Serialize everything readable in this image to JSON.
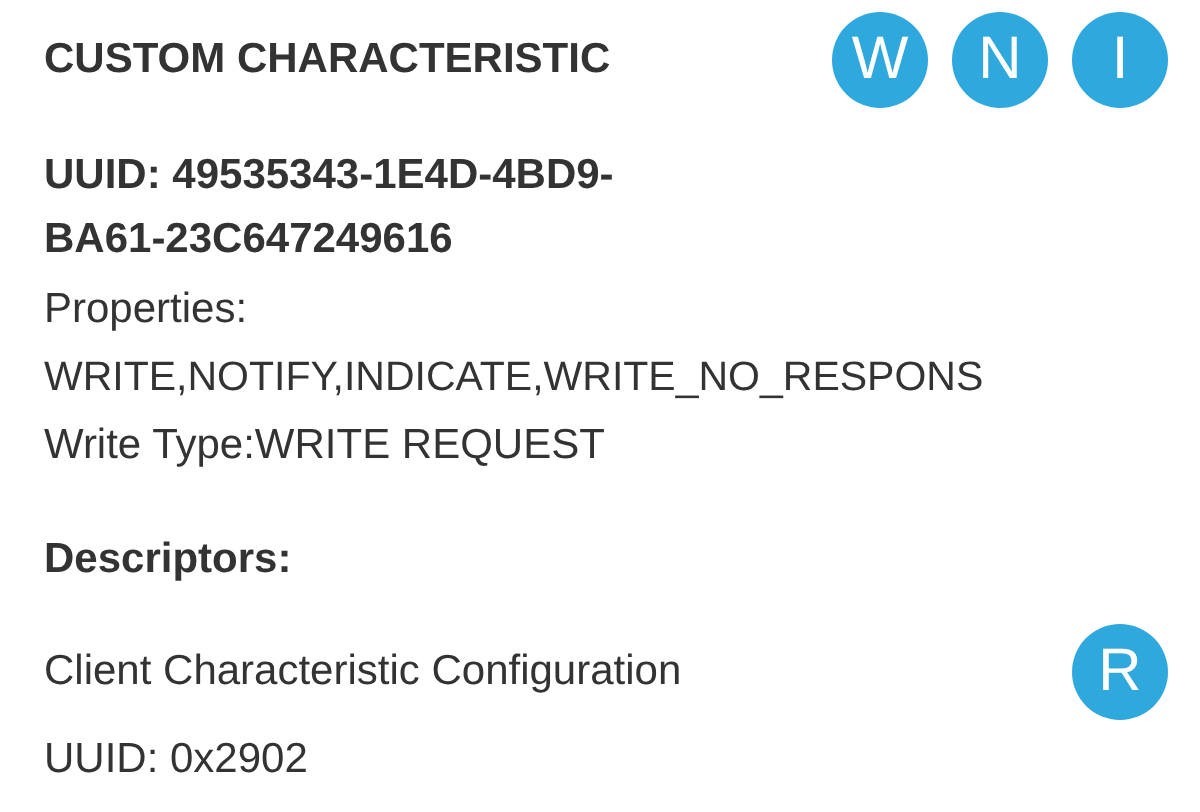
{
  "characteristic": {
    "title": "CUSTOM CHARACTERISTIC",
    "badges": [
      {
        "label": "W"
      },
      {
        "label": "N"
      },
      {
        "label": "I"
      }
    ],
    "uuid_lines": [
      "UUID: 49535343-1E4D-4BD9-",
      "BA61-23C647249616"
    ],
    "properties_label": "Properties:",
    "properties_value": "WRITE,NOTIFY,INDICATE,WRITE_NO_RESPONS",
    "write_type": "Write Type:WRITE REQUEST"
  },
  "descriptors": {
    "heading": "Descriptors:",
    "items": [
      {
        "name": "Client Characteristic Configuration",
        "uuid": "UUID: 0x2902",
        "badges": [
          {
            "label": "R"
          }
        ]
      }
    ]
  }
}
